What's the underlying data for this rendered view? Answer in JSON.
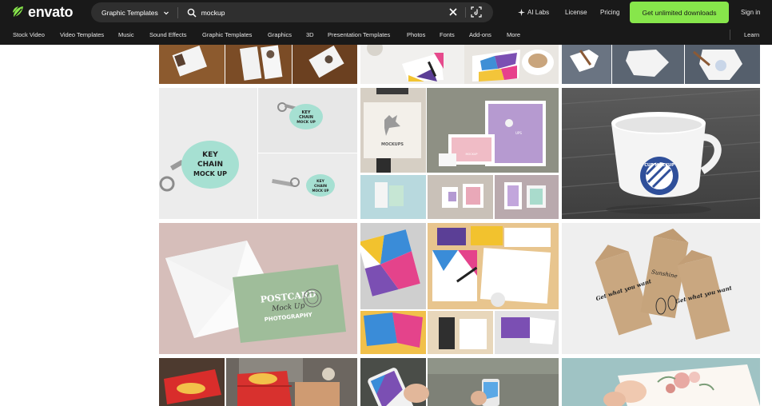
{
  "brand": {
    "logo_text": "envato",
    "accent": "#87e64b",
    "bar_bg": "#191919"
  },
  "search": {
    "category": "Graphic Templates",
    "query": "mockup",
    "icons": [
      "chevron-down-icon",
      "search-icon",
      "close-icon",
      "visual-search-icon"
    ]
  },
  "top_links": {
    "ai_labs": "AI Labs",
    "license": "License",
    "pricing": "Pricing",
    "cta": "Get unlimited downloads",
    "sign_in": "Sign in"
  },
  "nav": {
    "items": [
      "Stock Video",
      "Video Templates",
      "Music",
      "Sound Effects",
      "Graphic Templates",
      "Graphics",
      "3D",
      "Presentation Templates",
      "Photos",
      "Fonts",
      "Add-ons",
      "More"
    ],
    "learn": "Learn"
  },
  "tiles": {
    "keychain": {
      "line1": "KEY",
      "line2": "CHAIN",
      "line3": "MOCK UP"
    },
    "brand": {
      "mockups": "MOCKUPS",
      "ups": "UPS",
      "mockup_small": "MOCKUP"
    },
    "cup": {
      "label": "CUP MOCKUP"
    },
    "postcard": {
      "line1": "POSTCARD",
      "line2": "Mock Up",
      "line3": "PHOTOGRAPHY"
    },
    "envelopes": {
      "left": "Get what you want",
      "middle": "Sunshine",
      "right": "Get what you want"
    }
  }
}
